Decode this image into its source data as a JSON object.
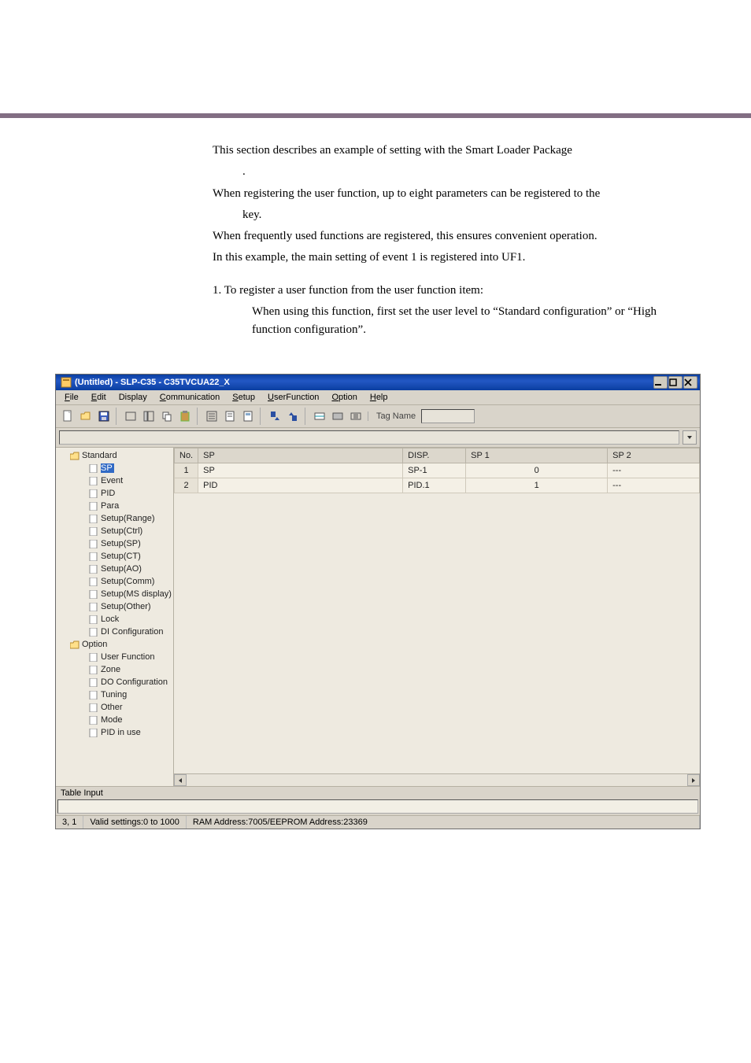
{
  "body_text": {
    "p1": "This section describes an example of setting with the Smart Loader Package",
    "p1_after": ".",
    "p2": "When registering the user function, up to eight parameters can be registered to the",
    "p2b": "key.",
    "p3": "When frequently used functions are registered, this ensures convenient operation.",
    "p4": "In this example, the main setting of event 1 is registered into UF1.",
    "step1": "1.  To register a user function from the user function item:",
    "step1a": "When using this function, first set the user level to “Standard configuration” or “High function configuration”."
  },
  "window": {
    "title": "(Untitled) - SLP-C35 - C35TVCUA22_X",
    "menu": [
      "File",
      "Edit",
      "Display",
      "Communication",
      "Setup",
      "UserFunction",
      "Option",
      "Help"
    ],
    "tag_label": "Tag Name",
    "tree": {
      "root1": "Standard",
      "root1_items": [
        "SP",
        "Event",
        "PID",
        "Para",
        "Setup(Range)",
        "Setup(Ctrl)",
        "Setup(SP)",
        "Setup(CT)",
        "Setup(AO)",
        "Setup(Comm)",
        "Setup(MS display)",
        "Setup(Other)",
        "Lock",
        "DI Configuration"
      ],
      "root2": "Option",
      "root2_items": [
        "User Function",
        "Zone",
        "DO Configuration",
        "Tuning",
        "Other",
        "Mode",
        "PID in use"
      ]
    },
    "table": {
      "headers": [
        "No.",
        "SP",
        "DISP.",
        "SP 1",
        "SP 2"
      ],
      "rows": [
        {
          "no": "1",
          "sp": "SP",
          "disp": "SP-1",
          "sp1": "0",
          "sp2": "---"
        },
        {
          "no": "2",
          "sp": "PID",
          "disp": "PID.1",
          "sp1": "1",
          "sp2": "---"
        }
      ]
    },
    "table_input_label": "Table Input",
    "status": {
      "cell1": "3, 1",
      "cell2": "Valid settings:0 to 1000",
      "cell3": "RAM Address:7005/EEPROM Address:23369"
    }
  }
}
